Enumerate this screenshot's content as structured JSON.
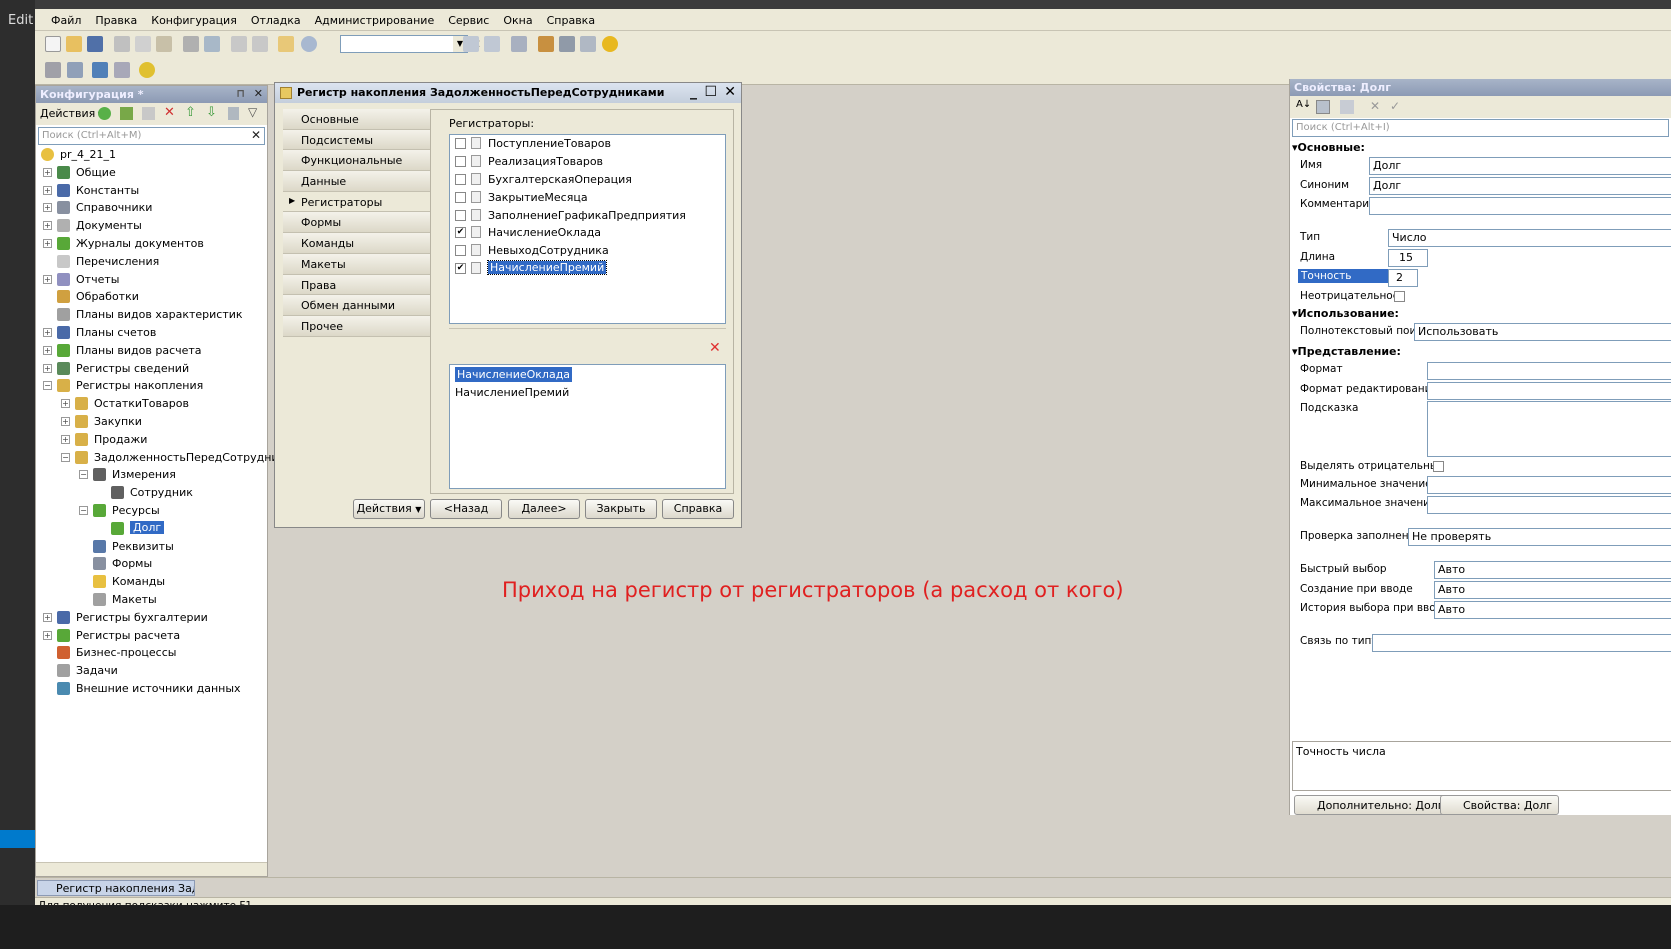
{
  "left_strip": {
    "edit_label": "Edit"
  },
  "menubar": [
    "Файл",
    "Правка",
    "Конфигурация",
    "Отладка",
    "Администрирование",
    "Сервис",
    "Окна",
    "Справка"
  ],
  "config": {
    "title": "Конфигурация *",
    "actions_label": "Действия",
    "search_placeholder": "Поиск (Ctrl+Alt+M)",
    "tree": [
      {
        "label": "pr_4_21_1",
        "indent": 0,
        "pm": "",
        "icon": "#e8c040"
      },
      {
        "label": "Общие",
        "indent": 1,
        "pm": "+",
        "icon": "#4a8a4a"
      },
      {
        "label": "Константы",
        "indent": 1,
        "pm": "+",
        "icon": "#4a6aa8"
      },
      {
        "label": "Справочники",
        "indent": 1,
        "pm": "+",
        "icon": "#8890a0"
      },
      {
        "label": "Документы",
        "indent": 1,
        "pm": "+",
        "icon": "#b0b0b0"
      },
      {
        "label": "Журналы документов",
        "indent": 1,
        "pm": "+",
        "icon": "#58a838"
      },
      {
        "label": "Перечисления",
        "indent": 1,
        "pm": "",
        "icon": "#c8c8c8"
      },
      {
        "label": "Отчеты",
        "indent": 1,
        "pm": "+",
        "icon": "#9090c0"
      },
      {
        "label": "Обработки",
        "indent": 1,
        "pm": "",
        "icon": "#d0a040"
      },
      {
        "label": "Планы видов характеристик",
        "indent": 1,
        "pm": "",
        "icon": "#a0a0a0"
      },
      {
        "label": "Планы счетов",
        "indent": 1,
        "pm": "+",
        "icon": "#4a6aa8"
      },
      {
        "label": "Планы видов расчета",
        "indent": 1,
        "pm": "+",
        "icon": "#58a838"
      },
      {
        "label": "Регистры сведений",
        "indent": 1,
        "pm": "+",
        "icon": "#5a8a5a"
      },
      {
        "label": "Регистры накопления",
        "indent": 1,
        "pm": "−",
        "icon": "#d8b048"
      },
      {
        "label": "ОстаткиТоваров",
        "indent": 2,
        "pm": "+",
        "icon": "#d8b048"
      },
      {
        "label": "Закупки",
        "indent": 2,
        "pm": "+",
        "icon": "#d8b048"
      },
      {
        "label": "Продажи",
        "indent": 2,
        "pm": "+",
        "icon": "#d8b048"
      },
      {
        "label": "ЗадолженностьПередСотрудниками",
        "indent": 2,
        "pm": "−",
        "icon": "#d8b048"
      },
      {
        "label": "Измерения",
        "indent": 3,
        "pm": "−",
        "icon": "#606060"
      },
      {
        "label": "Сотрудник",
        "indent": 4,
        "pm": "",
        "icon": "#606060"
      },
      {
        "label": "Ресурсы",
        "indent": 3,
        "pm": "−",
        "icon": "#58a838"
      },
      {
        "label": "Долг",
        "indent": 4,
        "pm": "",
        "icon": "#58a838",
        "selected": true
      },
      {
        "label": "Реквизиты",
        "indent": 3,
        "pm": "",
        "icon": "#5878a8"
      },
      {
        "label": "Формы",
        "indent": 3,
        "pm": "",
        "icon": "#8890a0"
      },
      {
        "label": "Команды",
        "indent": 3,
        "pm": "",
        "icon": "#e8c040"
      },
      {
        "label": "Макеты",
        "indent": 3,
        "pm": "",
        "icon": "#a0a0a0"
      },
      {
        "label": "Регистры бухгалтерии",
        "indent": 1,
        "pm": "+",
        "icon": "#4a6aa8"
      },
      {
        "label": "Регистры расчета",
        "indent": 1,
        "pm": "+",
        "icon": "#58a838"
      },
      {
        "label": "Бизнес-процессы",
        "indent": 1,
        "pm": "",
        "icon": "#d06030"
      },
      {
        "label": "Задачи",
        "indent": 1,
        "pm": "",
        "icon": "#a0a0a0"
      },
      {
        "label": "Внешние источники данных",
        "indent": 1,
        "pm": "",
        "icon": "#4a8ab0"
      }
    ]
  },
  "dialog": {
    "title": "Регистр накопления ЗадолженностьПередСотрудниками",
    "tabs": [
      "Основные",
      "Подсистемы",
      "Функциональные опции",
      "Данные",
      "Регистраторы",
      "Формы",
      "Команды",
      "Макеты",
      "Права",
      "Обмен данными",
      "Прочее"
    ],
    "active_tab": "Регистраторы",
    "registrators_label": "Регистраторы:",
    "registrators": [
      {
        "name": "ПоступлениеТоваров",
        "checked": false
      },
      {
        "name": "РеализацияТоваров",
        "checked": false
      },
      {
        "name": "БухгалтерскаяОперация",
        "checked": false
      },
      {
        "name": "ЗакрытиеМесяца",
        "checked": false
      },
      {
        "name": "ЗаполнениеГрафикаПредприятия",
        "checked": false
      },
      {
        "name": "НачислениеОклада",
        "checked": true
      },
      {
        "name": "НевыходСотрудника",
        "checked": false
      },
      {
        "name": "НачислениеПремий",
        "checked": true,
        "selected": true
      }
    ],
    "selected_list": [
      {
        "name": "НачислениеОклада",
        "selected": true
      },
      {
        "name": "НачислениеПремий",
        "selected": false
      }
    ],
    "buttons": {
      "actions": "Действия",
      "back": "<Назад",
      "next": "Далее>",
      "close": "Закрыть",
      "help": "Справка"
    }
  },
  "annotation": "Приход на регистр от регистраторов (а расход от кого)",
  "properties": {
    "title": "Свойства: Долг",
    "search_placeholder": "Поиск (Ctrl+Alt+I)",
    "sections": {
      "main": "Основные:",
      "usage": "Использование:",
      "view": "Представление:"
    },
    "name_label": "Имя",
    "name_value": "Долг",
    "synonym_label": "Синоним",
    "synonym_value": "Долг",
    "comment_label": "Комментарий",
    "comment_value": "",
    "type_label": "Тип",
    "type_value": "Число",
    "length_label": "Длина",
    "length_value": "15",
    "precision_label": "Точность",
    "precision_value": "2",
    "nonneg_label": "Неотрицательное",
    "fulltext_label": "Полнотекстовый поиск",
    "fulltext_value": "Использовать",
    "format_label": "Формат",
    "edit_format_label": "Формат редактирования",
    "tooltip_label": "Подсказка",
    "highlight_neg_label": "Выделять отрицательные",
    "min_label": "Минимальное значение",
    "max_label": "Максимальное значение",
    "fill_check_label": "Проверка заполнения",
    "fill_check_value": "Не проверять",
    "quick_choice_label": "Быстрый выбор",
    "quick_choice_value": "Авто",
    "create_on_input_label": "Создание при вводе",
    "create_on_input_value": "Авто",
    "choice_history_label": "История выбора при вводе",
    "choice_history_value": "Авто",
    "link_by_type_label": "Связь по типу",
    "description": "Точность числа",
    "tab_extra": "Дополнительно: Долг",
    "tab_props": "Свойства: Долг"
  },
  "taskbar": {
    "item": "Регистр накопления Задол..."
  },
  "status": "Для получения подсказки нажмите F1"
}
